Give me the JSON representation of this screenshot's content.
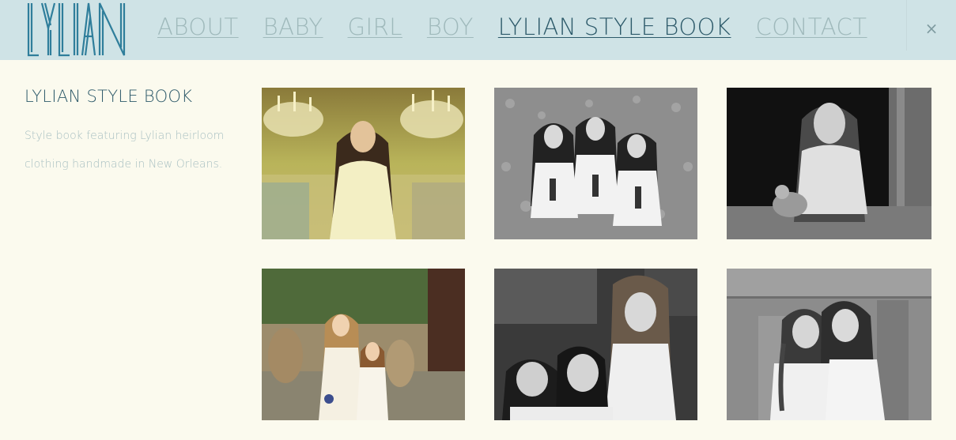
{
  "header": {
    "logo_text": "LYLIAN",
    "nav": [
      {
        "label": "ABOUT",
        "active": false
      },
      {
        "label": "BABY",
        "active": false
      },
      {
        "label": "GIRL",
        "active": false
      },
      {
        "label": "BOY",
        "active": false
      },
      {
        "label": "LYLIAN STYLE BOOK",
        "active": true
      },
      {
        "label": "CONTACT",
        "active": false
      }
    ],
    "close_glyph": "×",
    "close_icon": "close-icon"
  },
  "sidebar": {
    "title": "LYLIAN STYLE BOOK",
    "description": "Style book featuring Lylian heirloom clothing handmade in New Orleans."
  },
  "gallery": {
    "photos": [
      {
        "subject": "girl-under-chandeliers",
        "tone": "color"
      },
      {
        "subject": "three-girls-on-grass",
        "tone": "bw"
      },
      {
        "subject": "girl-in-window-with-doll",
        "tone": "bw"
      },
      {
        "subject": "two-girls-in-courtyard",
        "tone": "color"
      },
      {
        "subject": "three-girls-close-up",
        "tone": "bw"
      },
      {
        "subject": "two-girls-by-stone-wall",
        "tone": "bw"
      }
    ]
  },
  "colors": {
    "header_bg": "#cfe3e6",
    "page_bg": "#fbfaee",
    "nav_inactive": "#9fb9bb",
    "nav_active": "#2d5a6a",
    "logo": "#2f7e9b"
  }
}
